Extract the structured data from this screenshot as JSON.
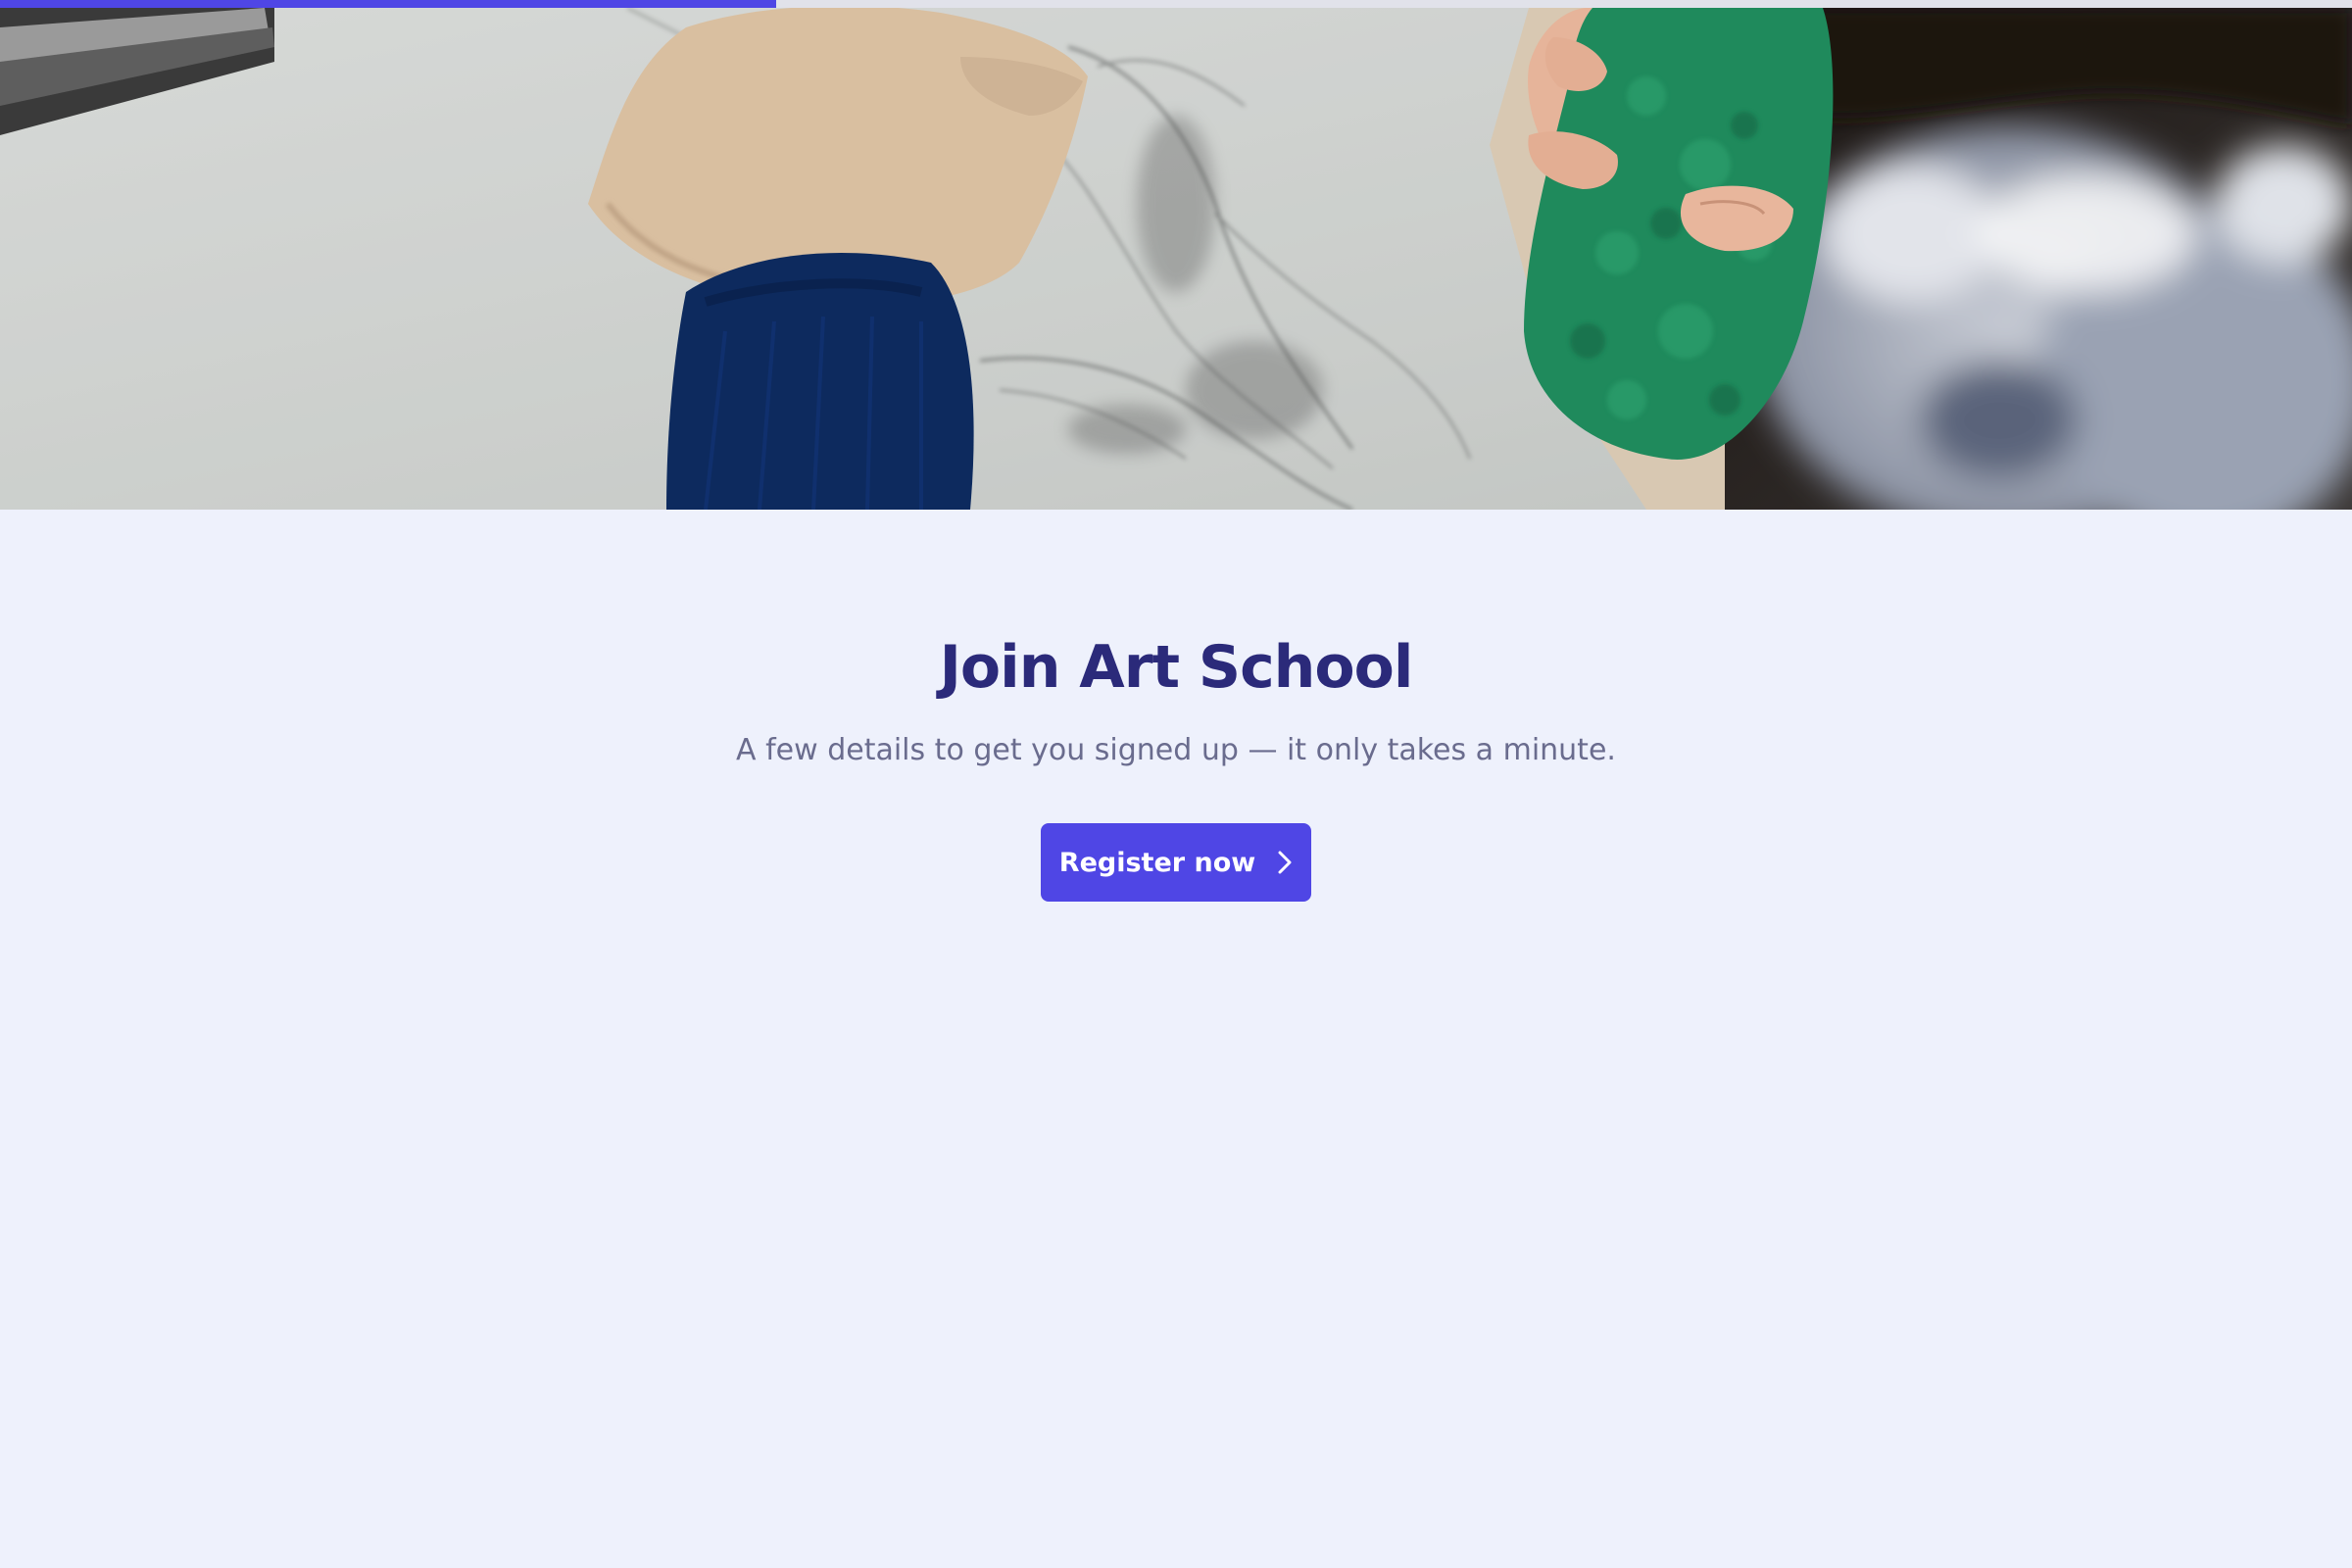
{
  "progress": {
    "fraction": 0.33,
    "color": "#4f46e5"
  },
  "hero": {
    "image_description": "hands sketching a charcoal drawing on paper, holding a green sponge"
  },
  "main": {
    "title": "Join Art School",
    "subtitle": "A few details to get you signed up — it only takes a minute.",
    "register_button": {
      "label": "Register now",
      "icon": "chevron-right-icon"
    }
  },
  "colors": {
    "accent": "#4f46e5",
    "title": "#2b2a7a",
    "subtitle": "#6a6c8e",
    "background": "#eef1fc"
  }
}
